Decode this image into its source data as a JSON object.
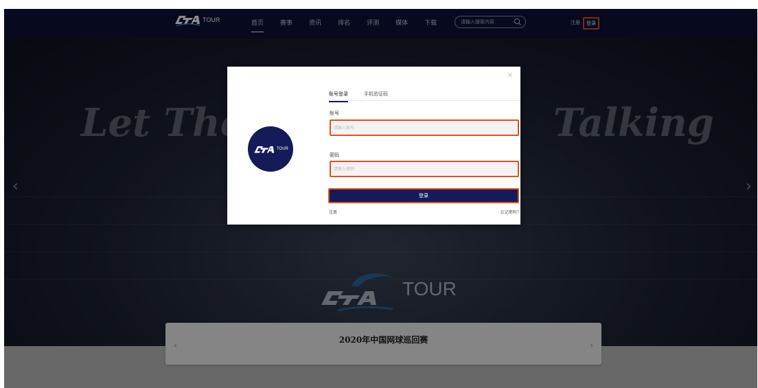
{
  "nav": {
    "logo_text": "TOUR",
    "items": [
      "首页",
      "赛事",
      "资讯",
      "排名",
      "评测",
      "媒体",
      "下载"
    ],
    "active_index": 0,
    "search_placeholder": "请输入搜索内容",
    "register": "注册",
    "login": "登录"
  },
  "hero": {
    "slogan_left": "Let The",
    "slogan_right": "Talking",
    "brand_text": "TOUR",
    "prev_arrow": "‹",
    "next_arrow": "›"
  },
  "banner": {
    "title": "2020年中国网球巡回赛",
    "prev_arrow": "‹",
    "next_arrow": "›"
  },
  "modal": {
    "close": "×",
    "logo_text": "TOUR",
    "tabs": [
      "账号登录",
      "手机验证码"
    ],
    "active_tab": 0,
    "account_label": "账号",
    "account_placeholder": "请输入账号",
    "password_label": "密码",
    "password_placeholder": "请输入密码",
    "submit": "登录",
    "register_link": "注册",
    "forgot_link": "忘记密码?"
  },
  "colors": {
    "nav_bg": "#0d1238",
    "brand": "#141b58",
    "highlight": "#e3501f"
  }
}
